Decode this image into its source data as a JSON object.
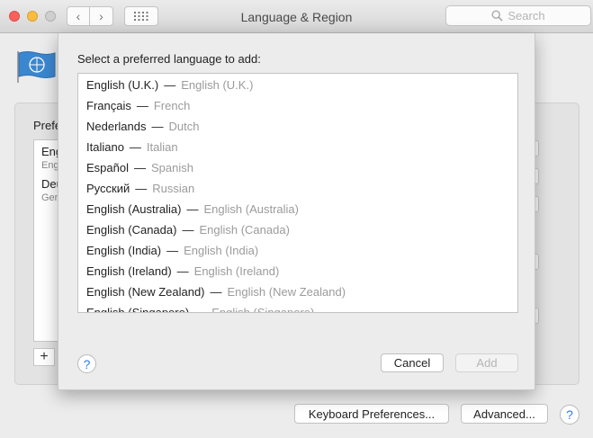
{
  "window": {
    "title": "Language & Region",
    "search_placeholder": "Search"
  },
  "background": {
    "preferred_label": "Prefe",
    "list_items": [
      {
        "name": "Eng",
        "sub": "Eng"
      },
      {
        "name": "Deu",
        "sub": "Gen"
      }
    ],
    "add_label": "+",
    "keyboard_button": "Keyboard Preferences...",
    "advanced_button": "Advanced...",
    "help_label": "?"
  },
  "sheet": {
    "title": "Select a preferred language to add:",
    "separator": "—",
    "languages": [
      {
        "native": "English (U.K.)",
        "english": "English (U.K.)"
      },
      {
        "native": "Français",
        "english": "French"
      },
      {
        "native": "Nederlands",
        "english": "Dutch"
      },
      {
        "native": "Italiano",
        "english": "Italian"
      },
      {
        "native": "Español",
        "english": "Spanish"
      },
      {
        "native": "Русский",
        "english": "Russian"
      },
      {
        "native": "English (Australia)",
        "english": "English (Australia)"
      },
      {
        "native": "English (Canada)",
        "english": "English (Canada)"
      },
      {
        "native": "English (India)",
        "english": "English (India)"
      },
      {
        "native": "English (Ireland)",
        "english": "English (Ireland)"
      },
      {
        "native": "English (New Zealand)",
        "english": "English (New Zealand)"
      },
      {
        "native": "English (Singapore)",
        "english": "English (Singapore)"
      }
    ],
    "help_label": "?",
    "cancel_label": "Cancel",
    "add_label": "Add"
  },
  "colors": {
    "accent": "#2b7cf6",
    "flag": "#3a87d0"
  }
}
